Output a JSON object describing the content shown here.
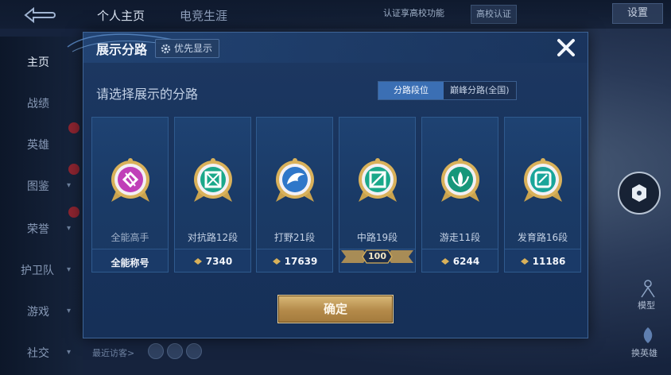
{
  "background": {
    "top_tabs": [
      "个人主页",
      "电竞生涯"
    ],
    "verify_text": "认证享高校功能",
    "campus_badge": "高校认证",
    "top_promo": "",
    "settings_label": "设置",
    "nav_items": [
      "主页",
      "战绩",
      "英雄",
      "图鉴",
      "荣誉",
      "护卫队",
      "游戏",
      "社交"
    ],
    "recent_visitors": "最近访客>",
    "right_labels": [
      "模型",
      "换英雄"
    ]
  },
  "modal": {
    "title": "展示分路",
    "priority_label": "优先显示",
    "subtitle": "请选择展示的分路",
    "tabs": [
      "分路段位",
      "巅峰分路(全国)"
    ],
    "active_tab": 0,
    "confirm_label": "确定",
    "cards": [
      {
        "name": "全能高手",
        "footer": "全能称号",
        "score": "",
        "icon": "all-round-badge-icon",
        "color": "#c03fb8"
      },
      {
        "name": "对抗路12段",
        "footer": "",
        "score": "7340",
        "icon": "clash-lane-badge-icon",
        "color": "#1aa88a"
      },
      {
        "name": "打野21段",
        "footer": "",
        "score": "17639",
        "icon": "jungle-badge-icon",
        "color": "#2f77c9"
      },
      {
        "name": "中路19段",
        "footer": "",
        "score": "",
        "rank_label": "100",
        "icon": "mid-lane-badge-icon",
        "color": "#1aa88a"
      },
      {
        "name": "游走11段",
        "footer": "",
        "score": "6244",
        "icon": "roam-badge-icon",
        "color": "#16977a"
      },
      {
        "name": "发育路16段",
        "footer": "",
        "score": "11186",
        "icon": "farm-lane-badge-icon",
        "color": "#19a59a"
      }
    ]
  },
  "colors": {
    "accent_tab": "#3b6fb4",
    "confirm_gold": "#c59e5c",
    "badge_gold": "#d9b15a"
  }
}
